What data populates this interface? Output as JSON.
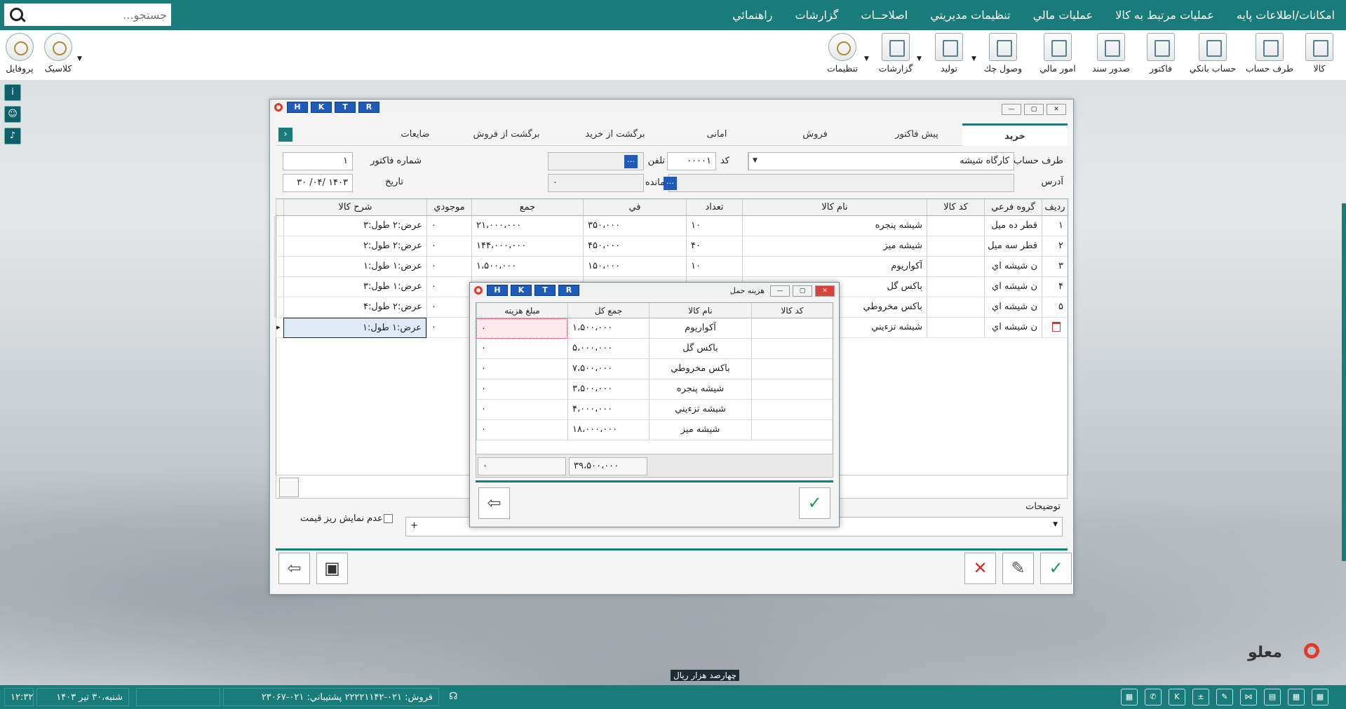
{
  "menu": {
    "items": [
      "امکانات/اطلاعات پايه",
      "عمليات مرتبط به کالا",
      "عمليات مالي",
      "تنظيمات مديريتي",
      "اصلاحــات",
      "گزارشات",
      "راهنمائي"
    ]
  },
  "search": {
    "placeholder": "جستجو..."
  },
  "toolbar": {
    "right": [
      "کالا",
      "طرف حساب",
      "حساب بانکي",
      "فاکتور",
      "صدور سند",
      "امور مالي",
      "وصول چك",
      "توليد",
      "گزارشات",
      "تنظيمات"
    ],
    "left": [
      "کلاسیک",
      "پروفايل"
    ]
  },
  "window": {
    "hktr": [
      "H",
      "K",
      "T",
      "R"
    ],
    "tabs": [
      "خريد",
      "پيش فاکتور",
      "فروش",
      "امانی",
      "برگشت از خرید",
      "برگشت از فروش",
      "ضايعات"
    ],
    "form": {
      "party_label": "طرف حساب",
      "party_value": "کارگاه شيشه",
      "code_label": "کد",
      "code_value": "۰۰۰۰۱",
      "phone_label": "تلفن",
      "invoice_label": "شماره فاکتور",
      "invoice_value": "۱",
      "address_label": "آدرس",
      "balance_label": "مانده",
      "balance_value": "۰",
      "date_label": "تاريخ",
      "date_value": "۱۴۰۳ /۰۴/ ۳۰"
    },
    "grid": {
      "headers": [
        "رديف",
        "گروه فرعي",
        "کد کالا",
        "نام کالا",
        "تعداد",
        "في",
        "جمع",
        "موجودي",
        "شرح کالا"
      ],
      "rows": [
        [
          "۱",
          "قطر ده ميل",
          "",
          "شيشه پنجره",
          "۱۰",
          "۳۵۰،۰۰۰",
          "۲۱،۰۰۰،۰۰۰",
          "۰",
          "عرض:۲ طول:۳"
        ],
        [
          "۲",
          "قطر سه ميل",
          "",
          "شيشه ميز",
          "۴۰",
          "۴۵۰،۰۰۰",
          "۱۴۴،۰۰۰،۰۰۰",
          "۰",
          "عرض:۲ طول:۲"
        ],
        [
          "۳",
          "ن شيشه اي",
          "",
          "آکواريوم",
          "۱۰",
          "۱۵۰،۰۰۰",
          "۱،۵۰۰،۰۰۰",
          "۰",
          "عرض:۱ طول:۱"
        ],
        [
          "۴",
          "ن شيشه اي",
          "",
          "باکس گل",
          "",
          "",
          "",
          "۰",
          "عرض:۱ طول:۳"
        ],
        [
          "۵",
          "ن شيشه اي",
          "",
          "باکس مخروطي",
          "",
          "",
          "",
          "۰",
          "عرض:۲ طول:۴"
        ],
        [
          "",
          "ن شيشه اي",
          "",
          "شيشه تزءيني",
          "",
          "",
          "",
          "۰",
          "عرض:۱ طول:۱"
        ]
      ]
    },
    "hide_price_label": "عدم نمايش ريز قيمت",
    "notes_label": "توضيحات",
    "notes_value": "+"
  },
  "modal": {
    "title": "هزينه حمل",
    "headers": [
      "کد کالا",
      "نام کالا",
      "جمع کل",
      "مبلغ هزينه"
    ],
    "rows": [
      [
        "",
        "آکواريوم",
        "۱،۵۰۰،۰۰۰",
        "۰"
      ],
      [
        "",
        "باکس گل",
        "۵،۰۰۰،۰۰۰",
        "۰"
      ],
      [
        "",
        "باکس مخروطي",
        "۷،۵۰۰،۰۰۰",
        "۰"
      ],
      [
        "",
        "شيشه پنجره",
        "۳،۵۰۰،۰۰۰",
        "۰"
      ],
      [
        "",
        "شيشه تزءيني",
        "۴،۰۰۰،۰۰۰",
        "۰"
      ],
      [
        "",
        "شيشه ميز",
        "۱۸،۰۰۰،۰۰۰",
        "۰"
      ]
    ],
    "total": "۳۹،۵۰۰،۰۰۰",
    "total_cost": "۰"
  },
  "amount_text": "چهارصد هزار ريال",
  "brand": "ﻣﻌﻠﻮ",
  "status": {
    "datetime": "شنبه،۳۰ تير ۱۴۰۳",
    "time": "۱۲:۳۲",
    "sales": "فروش: ۰۲۱-۲۲۲۲۱۱۴۲ پشتيباني: ۰۲۱-۲۳۰۶۷"
  }
}
